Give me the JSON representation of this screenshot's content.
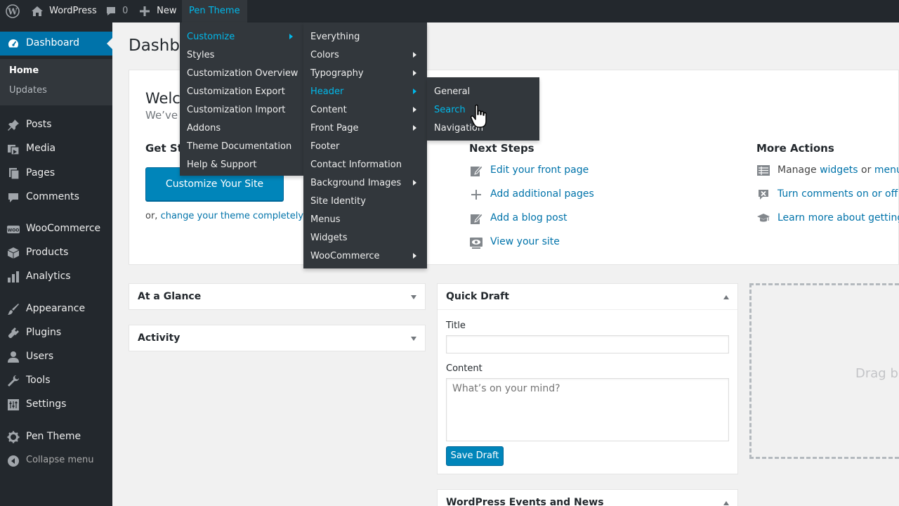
{
  "adminbar": {
    "site_name": "WordPress",
    "comments_count": "0",
    "new_label": "New",
    "theme_menu": "Pen Theme",
    "icons": [
      "wordpress-logo-icon",
      "home-icon",
      "comment-bubble-icon",
      "plus-icon"
    ]
  },
  "sidebar": {
    "dashboard": "Dashboard",
    "submenu": [
      "Home",
      "Updates"
    ],
    "items": [
      {
        "label": "Posts",
        "icon": "pin-icon"
      },
      {
        "label": "Media",
        "icon": "media-icon"
      },
      {
        "label": "Pages",
        "icon": "pages-icon"
      },
      {
        "label": "Comments",
        "icon": "comment-icon"
      },
      {
        "label": "WooCommerce",
        "icon": "woo-icon"
      },
      {
        "label": "Products",
        "icon": "box-icon"
      },
      {
        "label": "Analytics",
        "icon": "bar-chart-icon"
      },
      {
        "label": "Appearance",
        "icon": "brush-icon"
      },
      {
        "label": "Plugins",
        "icon": "plug-icon"
      },
      {
        "label": "Users",
        "icon": "user-icon"
      },
      {
        "label": "Tools",
        "icon": "wrench-icon"
      },
      {
        "label": "Settings",
        "icon": "settings-icon"
      },
      {
        "label": "Pen Theme",
        "icon": "gear-icon"
      }
    ],
    "collapse": "Collapse menu",
    "active_color": "#0073aa"
  },
  "page": {
    "title": "Dashbo",
    "welcome_title": "Welco",
    "welcome_sub": "We’ve",
    "get_started": "Get Sta",
    "customize_button": "Customize Your Site",
    "or_prefix": "or,",
    "or_link": "change your theme completely"
  },
  "next_steps": {
    "heading": "Next Steps",
    "items": [
      {
        "label": "Edit your front page",
        "icon": "edit-icon"
      },
      {
        "label": "Add additional pages",
        "icon": "plus-icon"
      },
      {
        "label": "Add a blog post",
        "icon": "edit-icon"
      },
      {
        "label": "View your site",
        "icon": "eye-icon"
      }
    ]
  },
  "more_actions": {
    "heading": "More Actions",
    "manage_prefix": "Manage",
    "widgets_link": "widgets",
    "or_text": "or",
    "menus_link": "menus",
    "comments_toggle": "Turn comments on or off",
    "learn_more": "Learn more about getting st"
  },
  "boxes": {
    "at_a_glance": "At a Glance",
    "activity": "Activity",
    "quick_draft": "Quick Draft",
    "title_label": "Title",
    "title_value": "",
    "content_label": "Content",
    "content_placeholder": "What’s on your mind?",
    "save_draft": "Save Draft",
    "events": "WordPress Events and News",
    "drag_text": "Drag bo"
  },
  "menu1": {
    "items": [
      "Customize",
      "Styles",
      "Customization Overview",
      "Customization Export",
      "Customization Import",
      "Addons",
      "Theme Documentation",
      "Help & Support"
    ],
    "active": "Customize"
  },
  "menu2": {
    "items": [
      "Everything",
      "Colors",
      "Typography",
      "Header",
      "Content",
      "Front Page",
      "Footer",
      "Contact Information",
      "Background Images",
      "Site Identity",
      "Menus",
      "Widgets",
      "WooCommerce"
    ],
    "active": "Header"
  },
  "menu3": {
    "items": [
      "General",
      "Search",
      "Navigation"
    ],
    "active": "Search"
  },
  "colors": {
    "link": "#0073aa",
    "highlight": "#00b9eb",
    "button": "#0085ba"
  }
}
